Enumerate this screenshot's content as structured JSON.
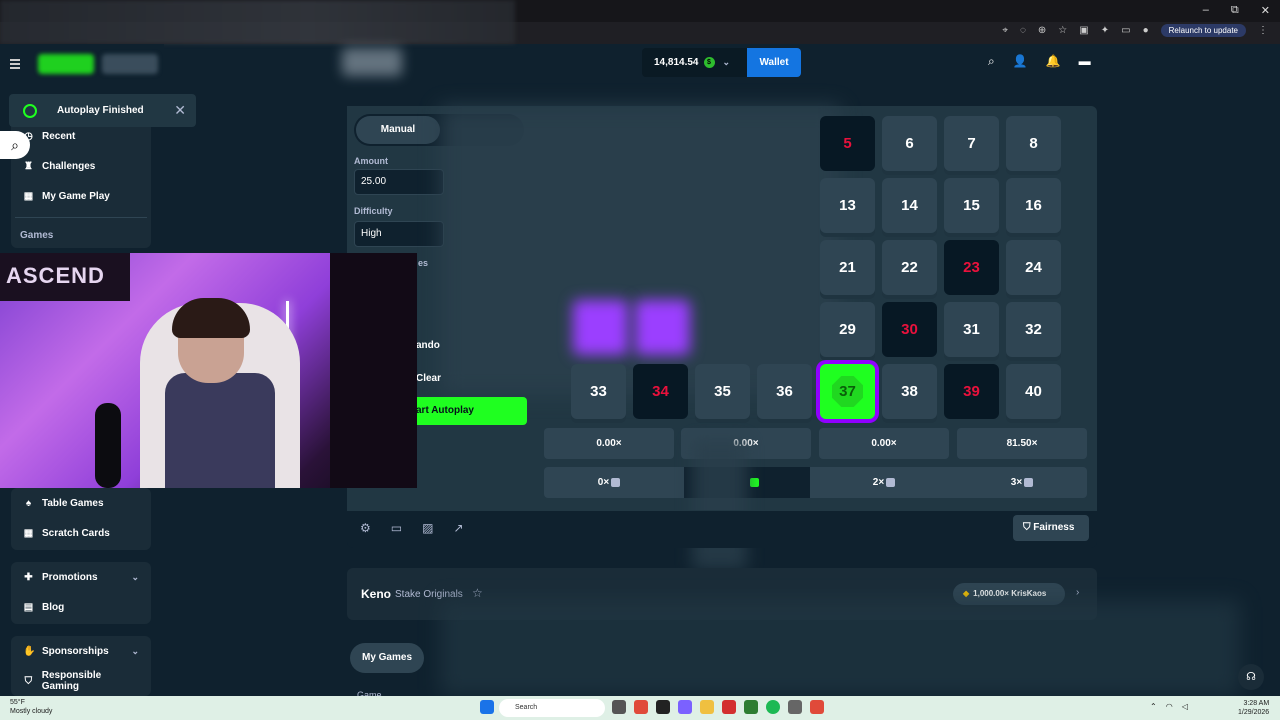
{
  "browser": {
    "relaunch_label": "Relaunch to update",
    "window_controls": [
      "–",
      "⧉",
      "✕"
    ]
  },
  "header": {
    "balance": "14,814.54",
    "coin_symbol": "$",
    "wallet_label": "Wallet"
  },
  "toast": {
    "text": "Autoplay Finished"
  },
  "sidebar": {
    "top_items": [
      {
        "label": "Recent",
        "icon": "clock-icon"
      },
      {
        "label": "Challenges",
        "icon": "trophy-icon"
      },
      {
        "label": "My Game Play",
        "icon": "game-play-icon"
      }
    ],
    "games_heading": "Games",
    "game_items": [
      {
        "label": "Table Games",
        "icon": "table-icon"
      },
      {
        "label": "Scratch Cards",
        "icon": "grid-icon"
      }
    ],
    "promo_items": [
      {
        "label": "Promotions",
        "icon": "gift-icon"
      },
      {
        "label": "Blog",
        "icon": "blog-icon"
      }
    ],
    "bottom_items": [
      {
        "label": "Sponsorships",
        "icon": "handshake-icon"
      },
      {
        "label": "Responsible Gaming",
        "icon": "shield-icon"
      }
    ]
  },
  "controls": {
    "tab_manual": "Manual",
    "amount_label": "Amount",
    "amount_value": "25.00",
    "difficulty_label": "Difficulty",
    "difficulty_value": "High",
    "partial_label_1": "es",
    "partial_label_2": "ando",
    "partial_label_3": "Clear",
    "autoplay_label": "art Autoplay"
  },
  "grid": {
    "visible_tiles": [
      {
        "n": "5",
        "state": "miss"
      },
      {
        "n": "6",
        "state": "normal"
      },
      {
        "n": "7",
        "state": "normal"
      },
      {
        "n": "8",
        "state": "normal"
      },
      {
        "n": "13",
        "state": "normal"
      },
      {
        "n": "14",
        "state": "normal"
      },
      {
        "n": "15",
        "state": "normal"
      },
      {
        "n": "16",
        "state": "normal"
      },
      {
        "n": "21",
        "state": "normal"
      },
      {
        "n": "22",
        "state": "normal"
      },
      {
        "n": "23",
        "state": "miss"
      },
      {
        "n": "24",
        "state": "normal"
      },
      {
        "n": "29",
        "state": "normal"
      },
      {
        "n": "30",
        "state": "miss"
      },
      {
        "n": "31",
        "state": "normal"
      },
      {
        "n": "32",
        "state": "normal"
      },
      {
        "n": "37",
        "state": "hit"
      },
      {
        "n": "38",
        "state": "normal"
      },
      {
        "n": "39",
        "state": "miss"
      },
      {
        "n": "40",
        "state": "normal"
      }
    ],
    "bottom_left_tiles": [
      {
        "n": "33",
        "state": "normal"
      },
      {
        "n": "34",
        "state": "miss"
      },
      {
        "n": "35",
        "state": "normal"
      },
      {
        "n": "36",
        "state": "normal"
      }
    ]
  },
  "payouts": [
    "0.00×",
    "0.00×",
    "0.00×",
    "81.50×"
  ],
  "hits": [
    "0×",
    "",
    "2×",
    "3×"
  ],
  "footer": {
    "fairness_label": "Fairness"
  },
  "info": {
    "title": "Keno",
    "subtitle": "Stake Originals",
    "record_value": "1,000.00×",
    "record_user": "KrisKaos"
  },
  "bottom": {
    "my_games_tab": "My Games",
    "game_column": "Game"
  },
  "webcam": {
    "banner_text": "ASCEND"
  },
  "taskbar": {
    "temp": "55°F",
    "weather": "Mostly cloudy",
    "search_placeholder": "Search",
    "time": "3:28 AM",
    "date": "1/29/2026"
  }
}
